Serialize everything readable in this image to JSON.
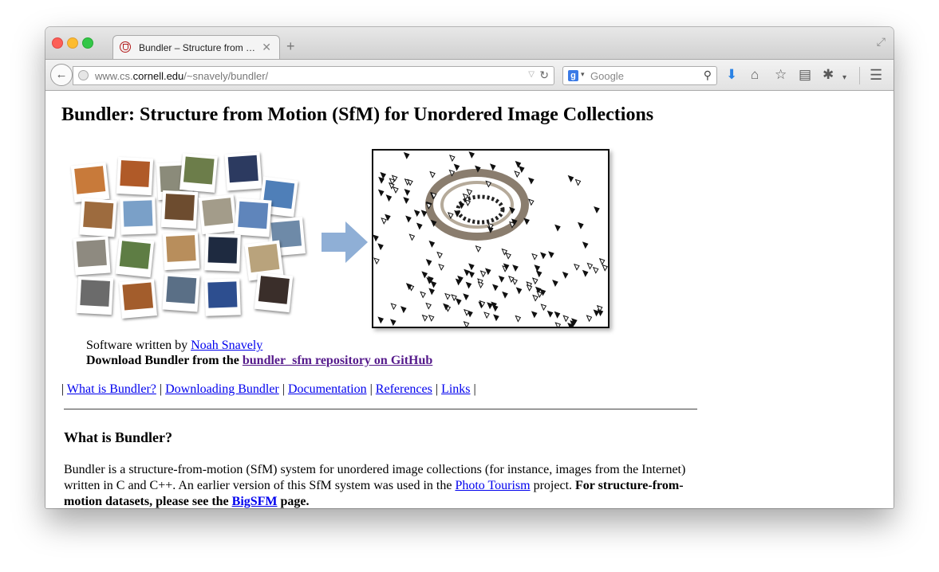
{
  "browser": {
    "tab_title": "Bundler – Structure from …",
    "tab_close": "✕",
    "new_tab": "+",
    "url_prefix": "www.cs.",
    "url_host": "cornell.edu",
    "url_path": "/~snavely/bundler/",
    "search_placeholder": "Google",
    "search_engine_letter": "g"
  },
  "page": {
    "title": "Bundler: Structure from Motion (SfM) for Unordered Image Collections",
    "credit_prefix": "Software written by ",
    "credit_author": "Noah Snavely",
    "download_prefix": "Download Bundler from the ",
    "download_link": "bundler_sfm repository on GitHub",
    "nav": [
      "What is Bundler?",
      "Downloading Bundler",
      "Documentation",
      "References",
      "Links"
    ],
    "section_heading": "What is Bundler?",
    "para_part1": "Bundler is a structure-from-motion (SfM) system for unordered image collections (for instance, images from the Internet) written in C and C++. An earlier version of this SfM system was used in the ",
    "photo_tourism_link": "Photo Tourism",
    "para_part2": " project. ",
    "para_bold": "For structure-from-motion datasets, please see the ",
    "bigsfm_link": "BigSFM",
    "para_bold_end": " page."
  },
  "icons": [
    "back-arrow-icon",
    "globe-icon",
    "reload-icon",
    "search-icon",
    "download-icon",
    "home-icon",
    "bookmark-star-icon",
    "reading-list-icon",
    "extension-icon",
    "menu-icon"
  ]
}
